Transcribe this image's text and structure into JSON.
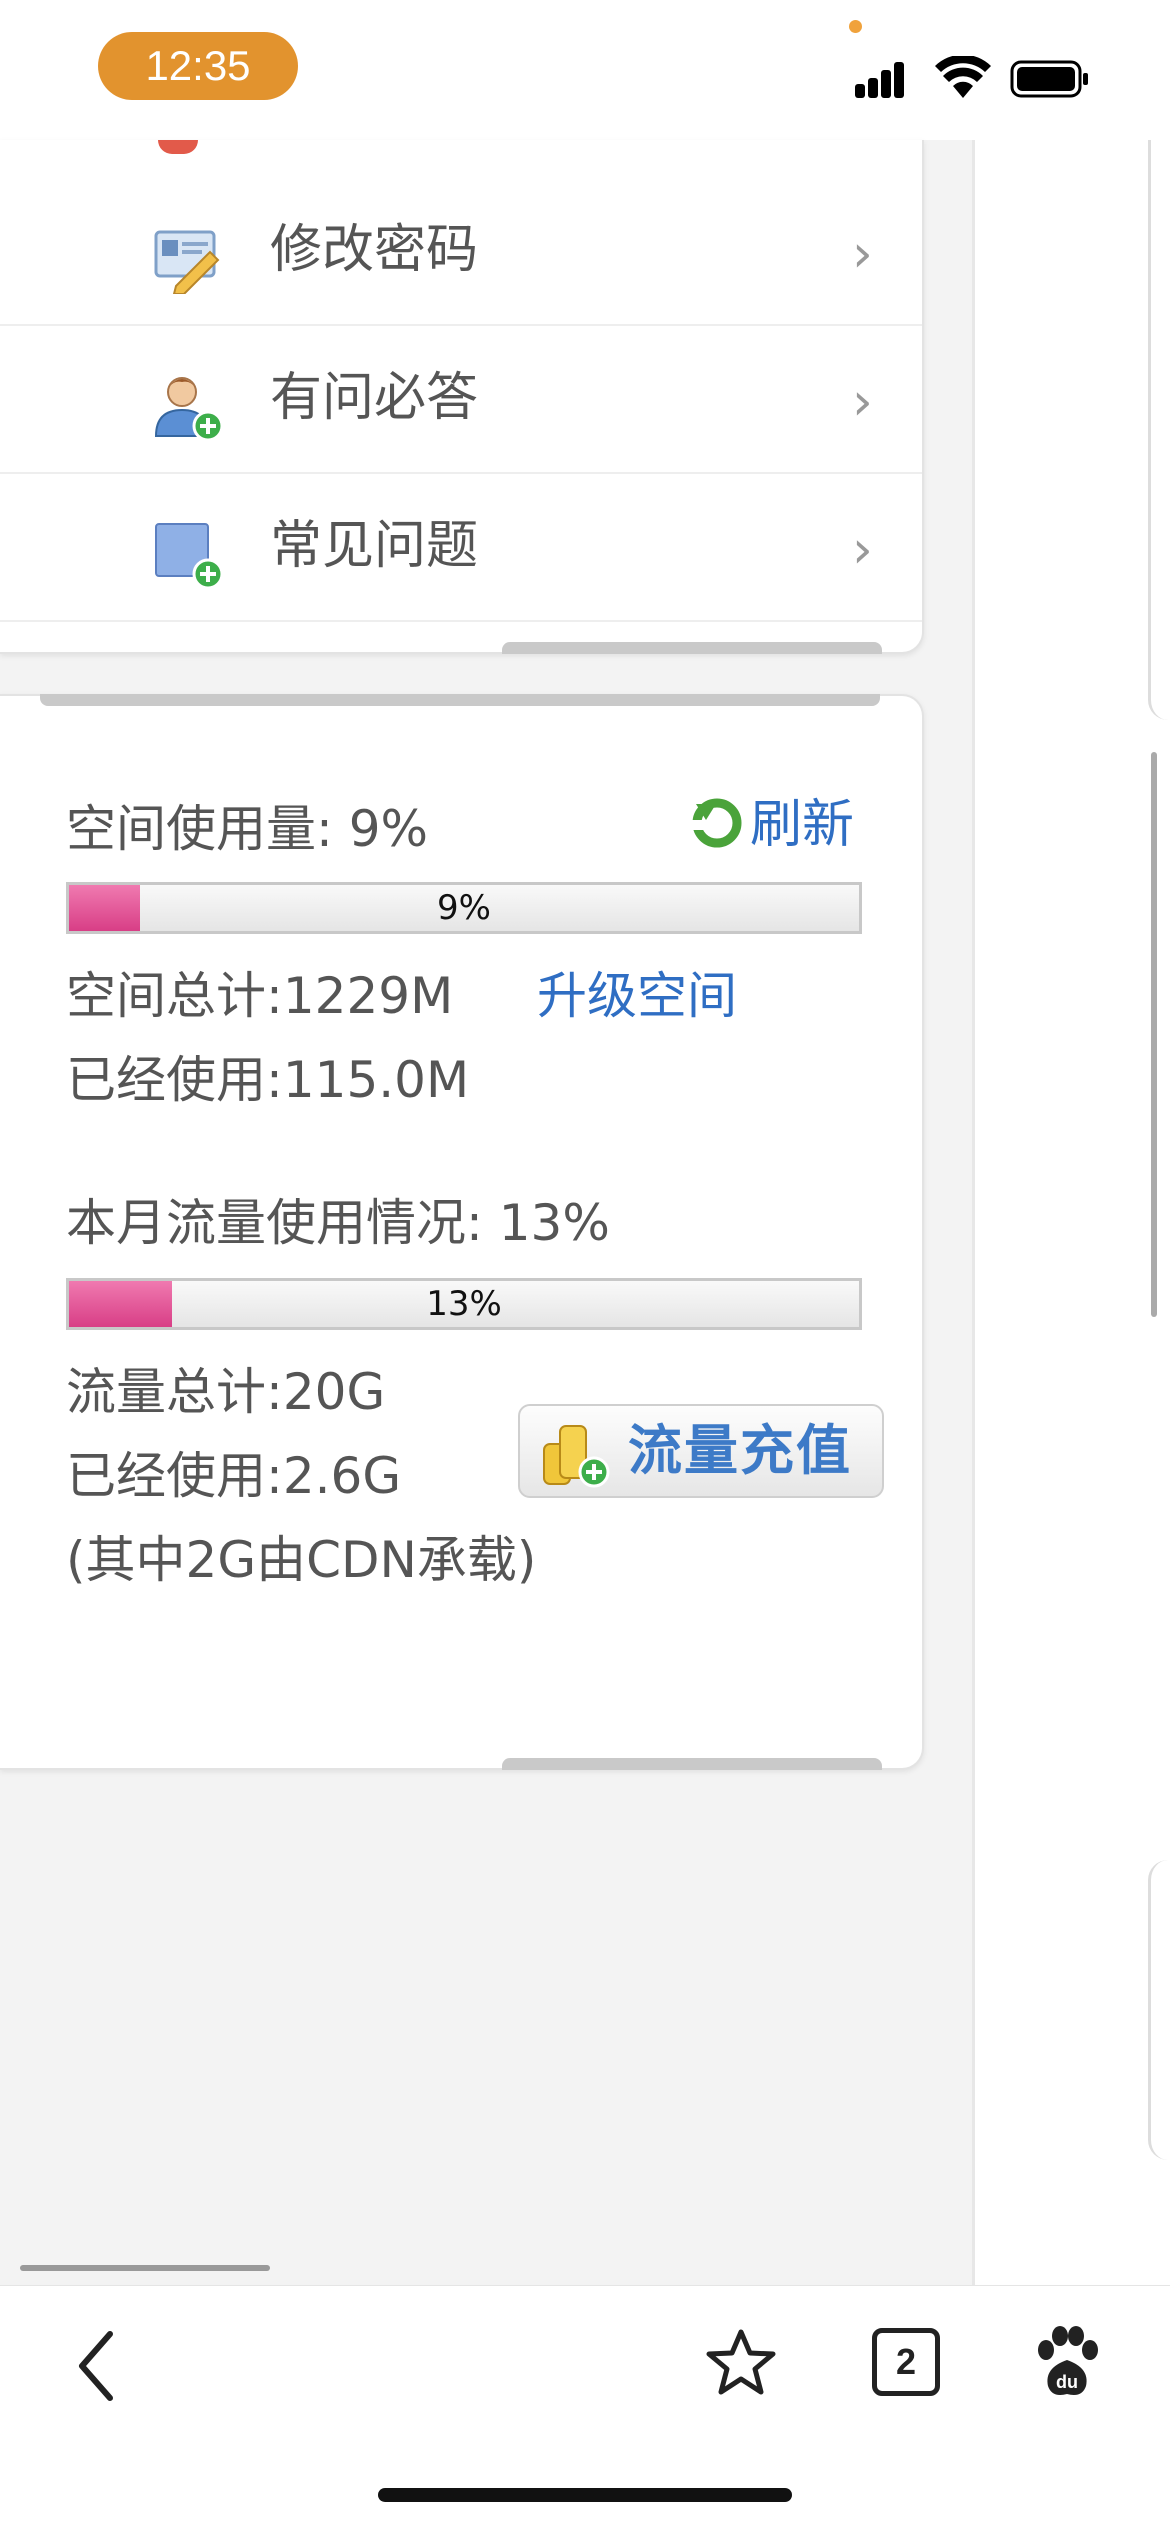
{
  "status_bar": {
    "time": "12:35"
  },
  "menu": {
    "items": [
      {
        "label": "修改密码",
        "icon": "password-edit-icon"
      },
      {
        "label": "有问必答",
        "icon": "user-add-icon"
      },
      {
        "label": "常见问题",
        "icon": "faq-add-icon"
      }
    ],
    "chevron": "›"
  },
  "storage": {
    "title": "空间使用量: 9%",
    "refresh_label": "刷新",
    "progress_text": "9%",
    "progress_value": 0.09,
    "total": "空间总计:1229M",
    "upgrade_label": "升级空间",
    "used": "已经使用:115.0M"
  },
  "traffic": {
    "title": "本月流量使用情况: 13%",
    "progress_text": "13%",
    "progress_value": 0.13,
    "total": "流量总计:20G",
    "used": "已经使用:2.6G",
    "cdn_note": "(其中2G由CDN承载)",
    "recharge_label": "流量充值"
  },
  "toolbar": {
    "tab_count": "2"
  },
  "colors": {
    "accent_blue": "#2f6ec3",
    "progress_pink": "#d83e86",
    "time_pill": "#e2932e"
  }
}
